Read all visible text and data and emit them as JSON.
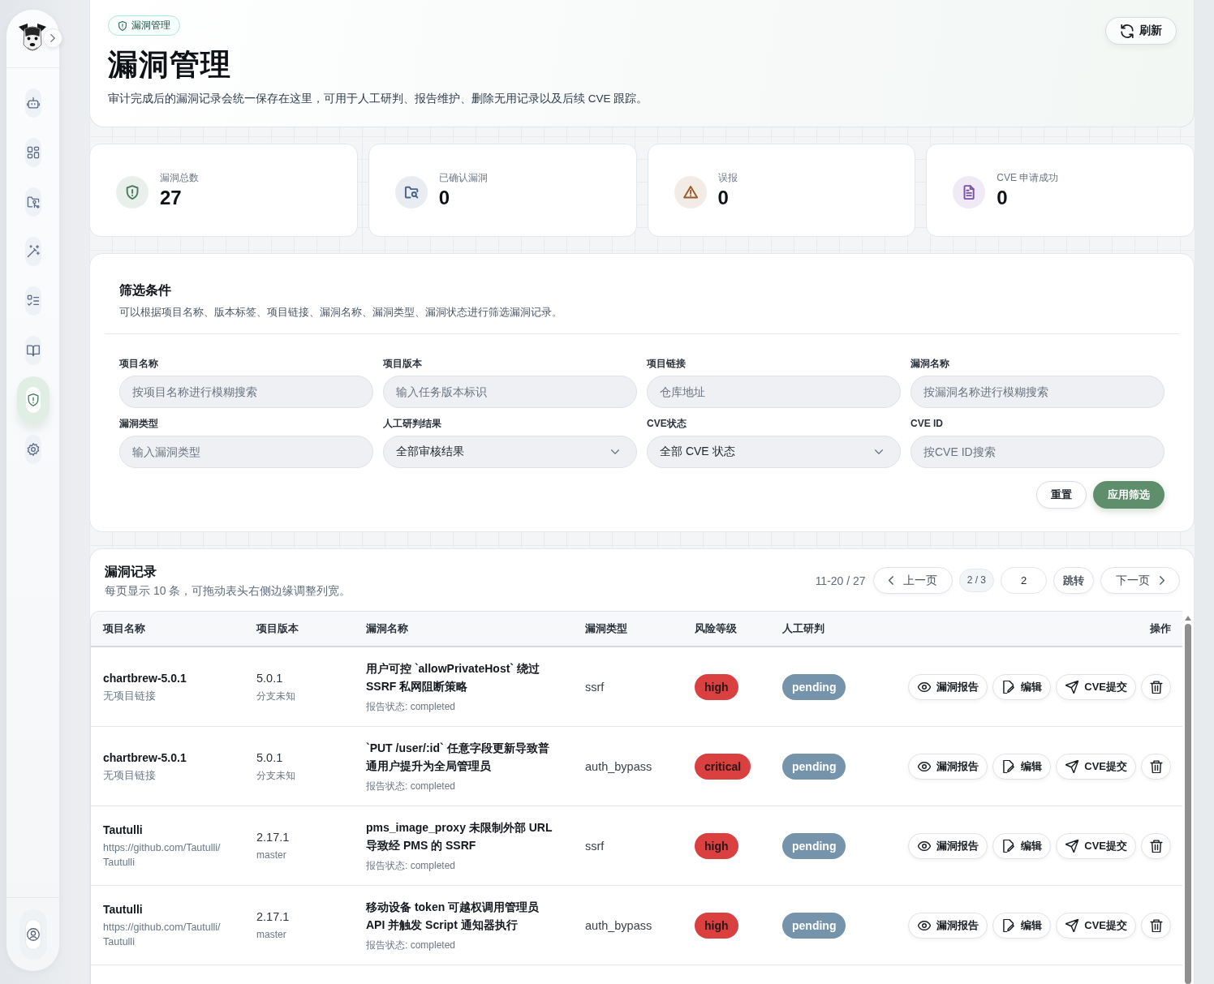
{
  "sidebar": {
    "nav_items": [
      {
        "selected": false
      },
      {
        "selected": false
      },
      {
        "selected": false
      },
      {
        "selected": false
      },
      {
        "selected": false
      },
      {
        "selected": false
      },
      {
        "selected": true
      },
      {
        "selected": false
      }
    ]
  },
  "header": {
    "badge": "漏洞管理",
    "title": "漏洞管理",
    "description": "审计完成后的漏洞记录会统一保存在这里，可用于人工研判、报告维护、删除无用记录以及后续 CVE 跟踪。",
    "refresh_button": "刷新"
  },
  "stats": [
    {
      "label": "漏洞总数",
      "value": "27",
      "color": "#4a7a5c"
    },
    {
      "label": "已确认漏洞",
      "value": "0",
      "color": "#44648a"
    },
    {
      "label": "误报",
      "value": "0",
      "color": "#9a5a28"
    },
    {
      "label": "CVE 申请成功",
      "value": "0",
      "color": "#7a52a8"
    }
  ],
  "filters": {
    "title": "筛选条件",
    "description": "可以根据项目名称、版本标签、项目链接、漏洞名称、漏洞类型、漏洞状态进行筛选漏洞记录。",
    "fields": [
      {
        "label": "项目名称",
        "kind": "text",
        "placeholder": "按项目名称进行模糊搜索"
      },
      {
        "label": "项目版本",
        "kind": "text",
        "placeholder": "输入任务版本标识"
      },
      {
        "label": "项目链接",
        "kind": "text",
        "placeholder": "仓库地址"
      },
      {
        "label": "漏洞名称",
        "kind": "text",
        "placeholder": "按漏洞名称进行模糊搜索"
      },
      {
        "label": "漏洞类型",
        "kind": "text",
        "placeholder": "输入漏洞类型"
      },
      {
        "label": "人工研判结果",
        "kind": "select",
        "value": "全部审核结果"
      },
      {
        "label": "CVE状态",
        "kind": "select",
        "value": "全部 CVE 状态"
      },
      {
        "label": "CVE ID",
        "kind": "text",
        "placeholder": "按CVE ID搜索"
      }
    ],
    "reset_button": "重置",
    "apply_button": "应用筛选"
  },
  "records": {
    "title": "漏洞记录",
    "description": "每页显示 10 条，可拖动表头右侧边缘调整列宽。",
    "pagination": {
      "range": "11-20 / 27",
      "prev_button": "上一页",
      "page_indicator": "2 / 3",
      "page_input": "2",
      "jump_button": "跳转",
      "next_button": "下一页"
    },
    "table": {
      "columns": [
        "项目名称",
        "项目版本",
        "漏洞名称",
        "漏洞类型",
        "风险等级",
        "人工研判",
        "操作"
      ],
      "rows": [
        {
          "project": "chartbrew-5.0.1",
          "project_link": "无项目链接",
          "version": "5.0.1",
          "branch": "分支未知",
          "vuln_name": "用户可控 `allowPrivateHost` 绕过 SSRF 私网阻断策略",
          "report_status": "报告状态: completed",
          "type": "ssrf",
          "risk": "high",
          "review": "pending",
          "actions": [
            {
              "kind": "report",
              "label": "漏洞报告"
            },
            {
              "kind": "edit",
              "label": "编辑"
            },
            {
              "kind": "cve",
              "label": "CVE提交"
            },
            {
              "kind": "delete"
            }
          ]
        },
        {
          "project": "chartbrew-5.0.1",
          "project_link": "无项目链接",
          "version": "5.0.1",
          "branch": "分支未知",
          "vuln_name": "`PUT /user/:id` 任意字段更新导致普通用户提升为全局管理员",
          "report_status": "报告状态: completed",
          "type": "auth_bypass",
          "risk": "critical",
          "review": "pending",
          "actions": [
            {
              "kind": "report",
              "label": "漏洞报告"
            },
            {
              "kind": "edit",
              "label": "编辑"
            },
            {
              "kind": "cve",
              "label": "CVE提交"
            },
            {
              "kind": "delete"
            }
          ]
        },
        {
          "project": "Tautulli",
          "project_link": "https://github.com/Tautulli/Tautulli",
          "version": "2.17.1",
          "branch": "master",
          "vuln_name": "pms_image_proxy 未限制外部 URL 导致经 PMS 的 SSRF",
          "report_status": "报告状态: completed",
          "type": "ssrf",
          "risk": "high",
          "review": "pending",
          "actions": [
            {
              "kind": "report",
              "label": "漏洞报告"
            },
            {
              "kind": "edit",
              "label": "编辑"
            },
            {
              "kind": "cve",
              "label": "CVE提交"
            },
            {
              "kind": "delete"
            }
          ]
        },
        {
          "project": "Tautulli",
          "project_link": "https://github.com/Tautulli/Tautulli",
          "version": "2.17.1",
          "branch": "master",
          "vuln_name": "移动设备 token 可越权调用管理员 API 并触发 Script 通知器执行",
          "report_status": "报告状态: completed",
          "type": "auth_bypass",
          "risk": "high",
          "review": "pending",
          "actions": [
            {
              "kind": "report",
              "label": "漏洞报告"
            },
            {
              "kind": "edit",
              "label": "编辑"
            },
            {
              "kind": "cve",
              "label": "CVE提交"
            },
            {
              "kind": "delete"
            }
          ]
        }
      ]
    }
  }
}
